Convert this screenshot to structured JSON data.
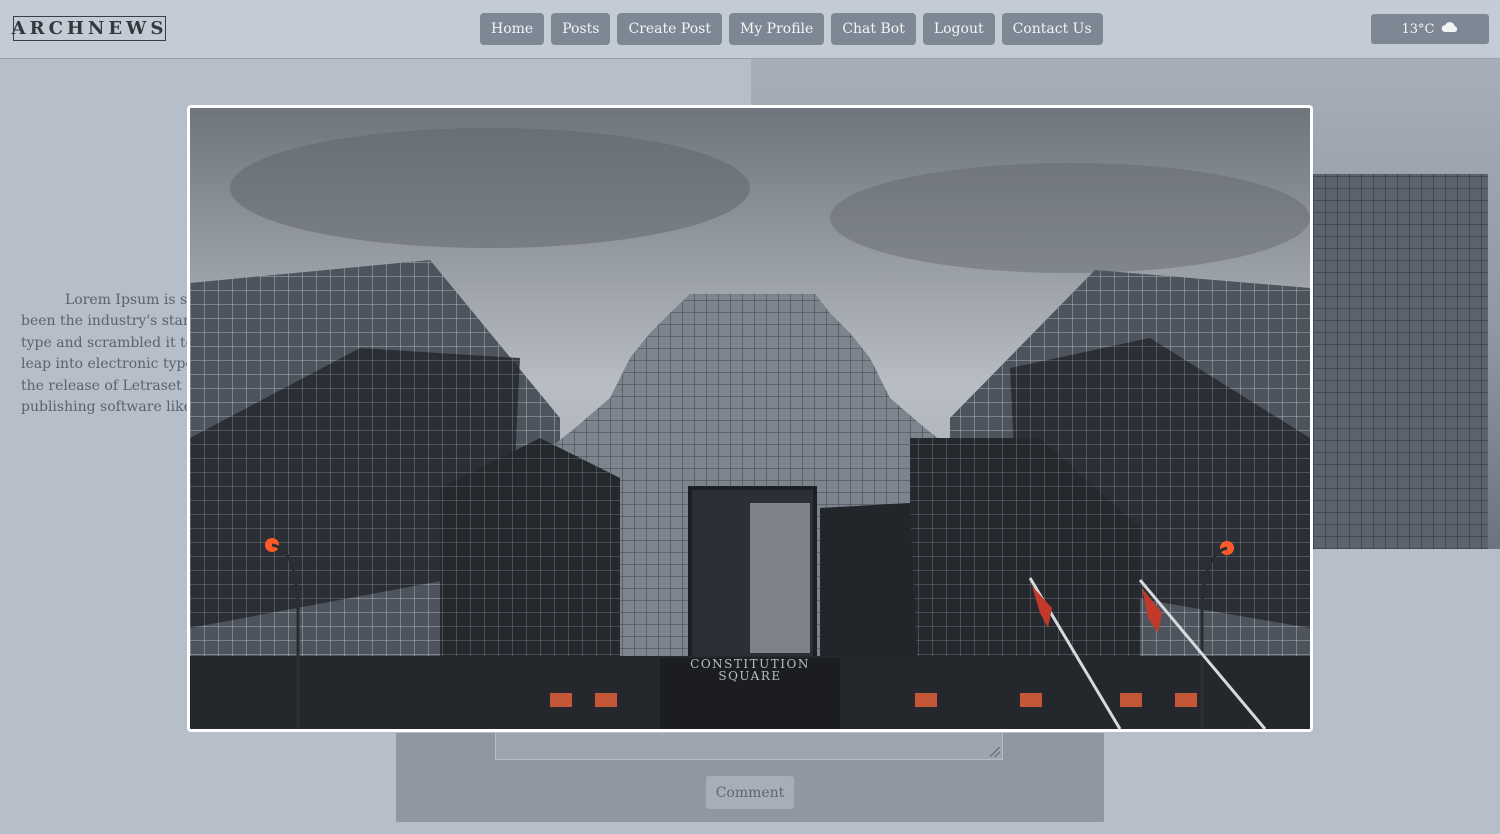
{
  "header": {
    "logo": "ARCHNEWS",
    "nav": [
      "Home",
      "Posts",
      "Create Post",
      "My Profile",
      "Chat Bot",
      "Logout",
      "Contact Us"
    ],
    "weather": {
      "temperature": "13°C",
      "icon": "cloud-icon"
    }
  },
  "article": {
    "lines": [
      "Lorem Ipsum is sir",
      "been the industry's stand",
      "type and scrambled it to",
      "leap into electronic types",
      "the release of Letraset sh",
      "publishing software like A"
    ]
  },
  "comments": {
    "button_label": "Comment"
  },
  "modal": {
    "image_sign": [
      "CONSTITUTION",
      "SQUARE"
    ]
  }
}
